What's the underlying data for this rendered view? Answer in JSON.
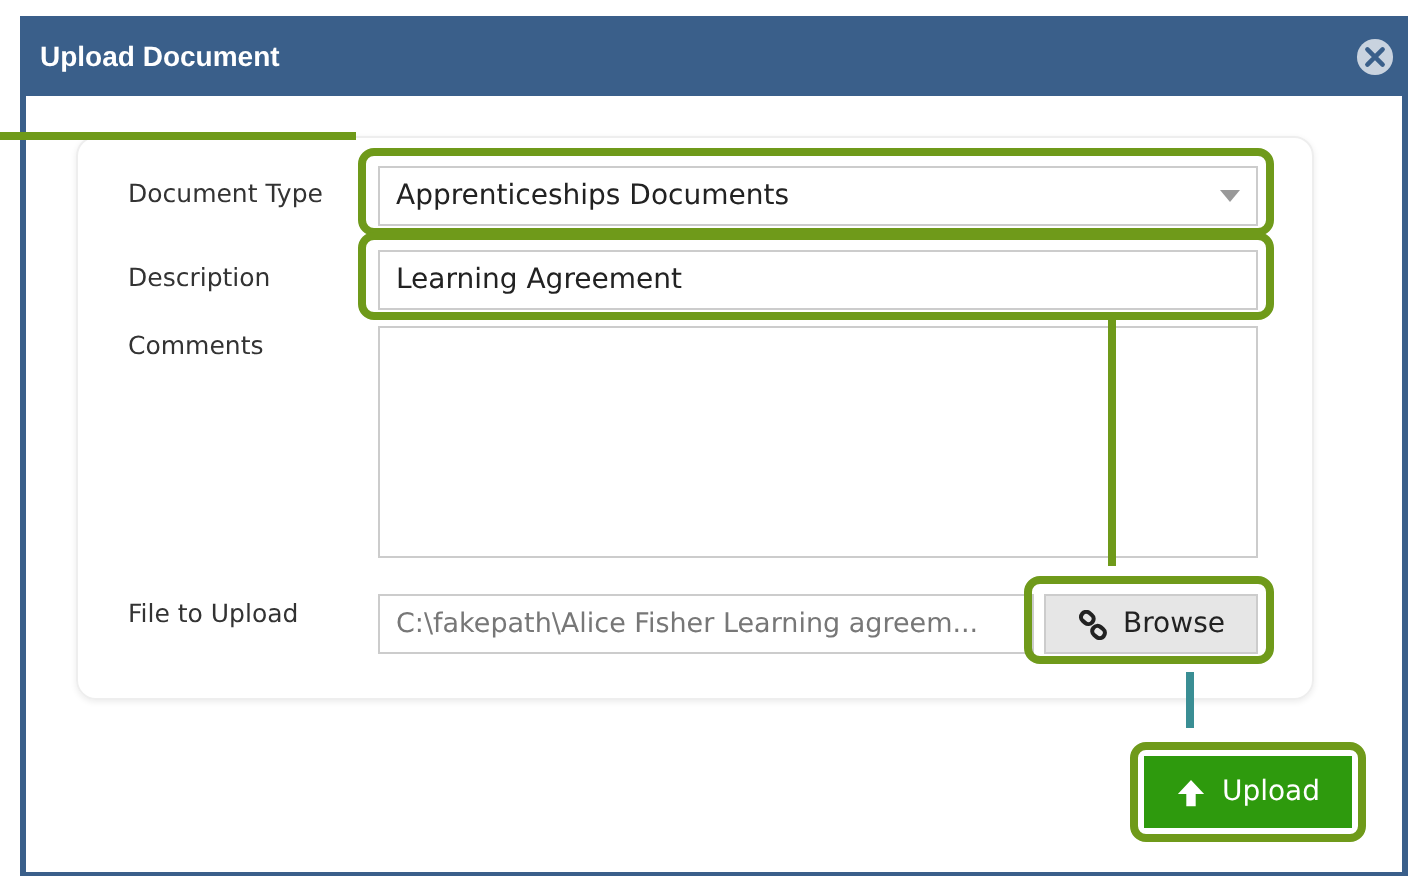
{
  "window": {
    "title": "Upload Document"
  },
  "form": {
    "fields": [
      {
        "kind": "select",
        "label": "Document Type",
        "value": "Apprenticeships Documents",
        "highlighted": true
      },
      {
        "kind": "text",
        "label": "Description",
        "value": "Learning Agreement",
        "highlighted": true
      },
      {
        "kind": "textarea",
        "label": "Comments",
        "highlighted": false
      },
      {
        "kind": "file",
        "label": "File to Upload",
        "value": "C:\\fakepath\\Alice Fisher Learning agreem...",
        "button": "Browse",
        "highlighted": true
      }
    ]
  },
  "upload_button": {
    "label": "Upload",
    "highlighted": true
  }
}
